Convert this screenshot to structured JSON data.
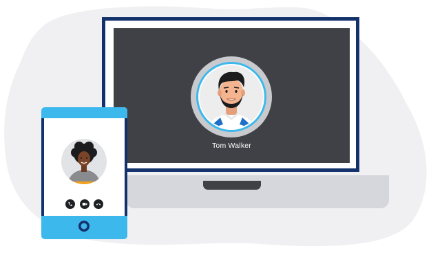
{
  "laptop": {
    "caller_name": "Tom Walker"
  },
  "phone": {
    "controls": {
      "call_icon": "phone-icon",
      "video_icon": "video-icon",
      "end_icon": "end-call-icon"
    }
  },
  "colors": {
    "background_blob": "#f0f0f2",
    "frame_navy": "#13316b",
    "screen_dark": "#3f4146",
    "accent_blue": "#3db8ec",
    "laptop_base": "#d5d7dc"
  }
}
